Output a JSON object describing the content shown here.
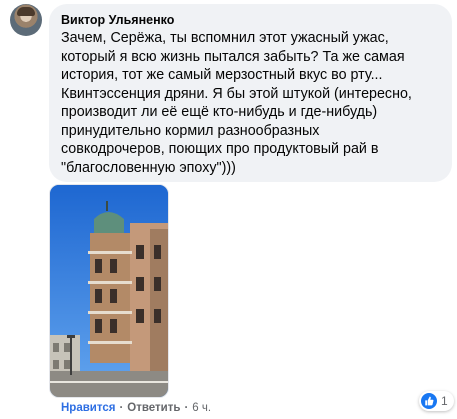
{
  "comment": {
    "author": "Виктор Ульяненко",
    "text": "Зачем, Серёжа, ты вспомнил этот ужасный ужас,\nкоторый я всю жизнь пытался забыть? Та же самая\nистория, тот же самый мерзостный вкус во рту...\nКвинтэссенция дряни. Я бы этой штукой (интересно,\nпроизводит ли её ещё кто-нибудь и где-нибудь)\nпринудительно кормил разнообразных\nсовкодрочеров, поющих про продуктовый рай в\n\"благословенную эпоху\")))",
    "attachment_icon": "photo"
  },
  "actions": {
    "like_label": "Нравится",
    "reply_label": "Ответить",
    "separator": "·",
    "time": "6 ч."
  },
  "reactions": {
    "icon": "like-icon",
    "count": "1"
  },
  "colors": {
    "bubble": "#f0f2f5",
    "accent": "#2d6ee3",
    "like": "#1877f2",
    "muted": "#65676b"
  }
}
